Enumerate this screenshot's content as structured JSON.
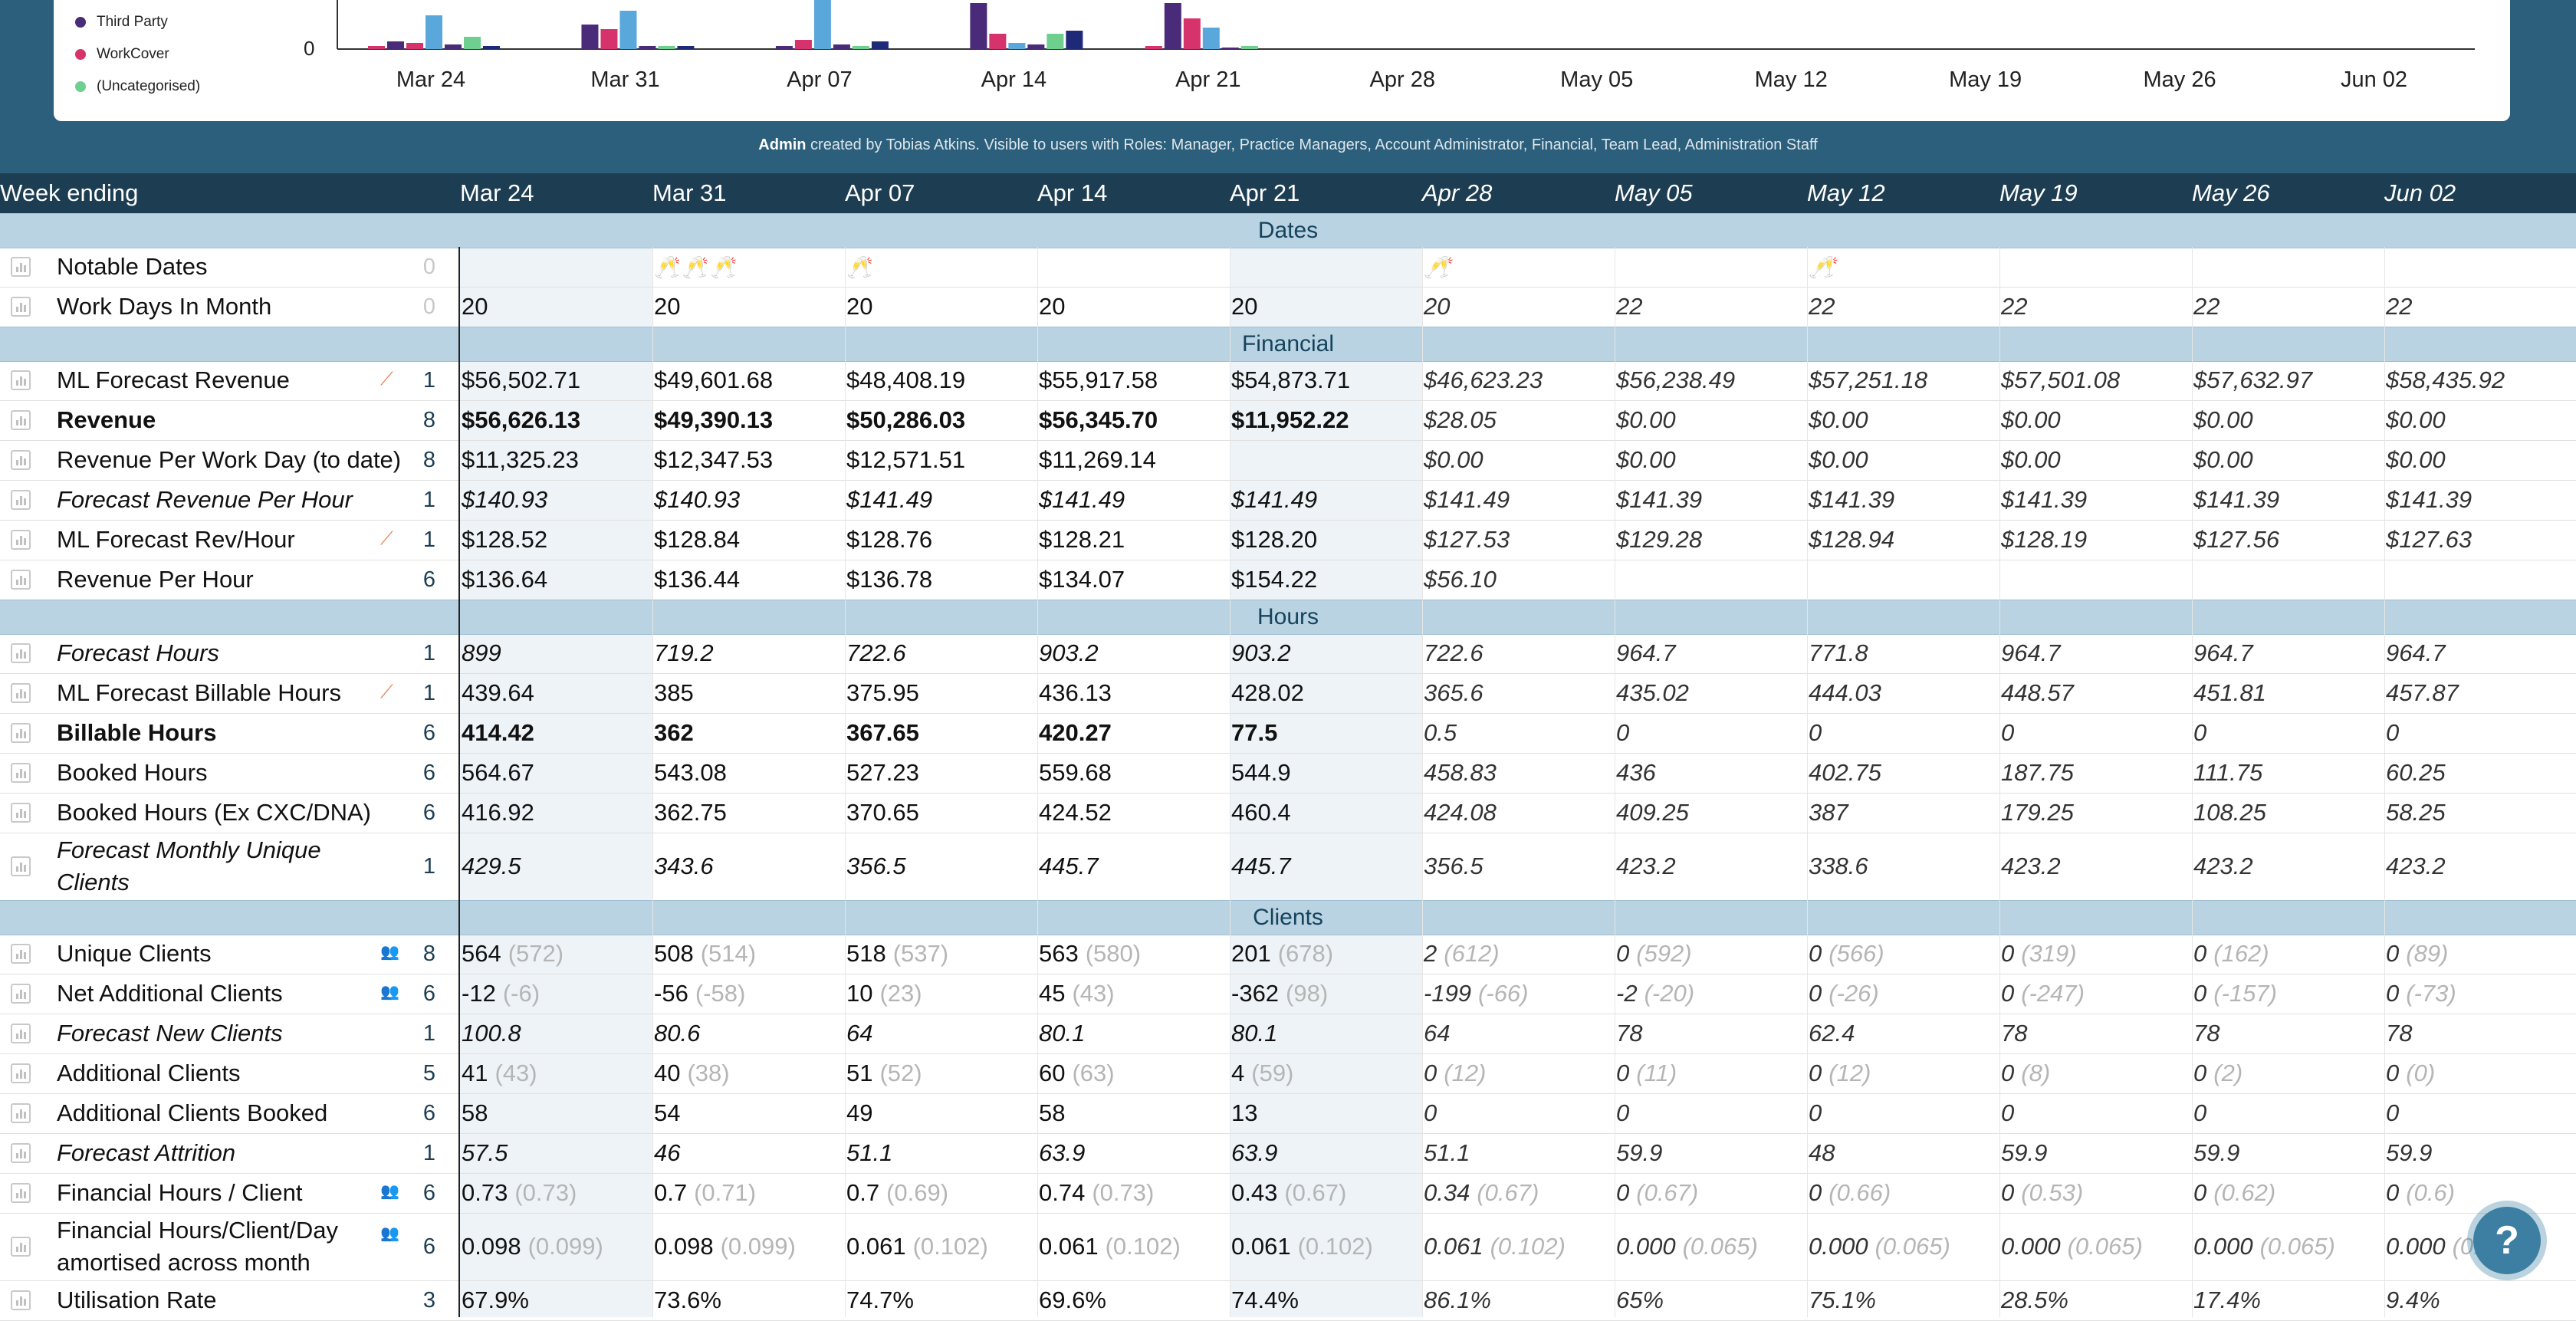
{
  "chart": {
    "legend": [
      {
        "label": "Third Party",
        "color": "#4a2b7a"
      },
      {
        "label": "WorkCover",
        "color": "#d6336c"
      },
      {
        "label": "(Uncategorised)",
        "color": "#6fcf8f"
      }
    ],
    "zero_label": "0",
    "x_labels": [
      "Mar 24",
      "Mar 31",
      "Apr 07",
      "Apr 14",
      "Apr 21",
      "Apr 28",
      "May 05",
      "May 12",
      "May 19",
      "May 26",
      "Jun 02"
    ]
  },
  "chart_data": {
    "type": "bar",
    "categories": [
      "Mar 24",
      "Mar 31",
      "Apr 07",
      "Apr 14",
      "Apr 21",
      "Apr 28",
      "May 05",
      "May 12",
      "May 19",
      "May 26",
      "Jun 02"
    ],
    "series": [
      {
        "color": "#d6336c",
        "values": [
          2,
          0,
          0,
          0,
          2,
          0,
          0,
          0,
          0,
          0,
          0
        ]
      },
      {
        "color": "#4a2b7a",
        "values": [
          5,
          16,
          2,
          30,
          30,
          0,
          0,
          0,
          0,
          0,
          0
        ]
      },
      {
        "color": "#d6336c",
        "values": [
          4,
          13,
          6,
          10,
          20,
          0,
          0,
          0,
          0,
          0,
          0
        ]
      },
      {
        "color": "#5aa7dc",
        "values": [
          22,
          25,
          32,
          4,
          14,
          0,
          0,
          0,
          0,
          0,
          0
        ]
      },
      {
        "color": "#4a2b7a",
        "values": [
          3,
          2,
          3,
          3,
          1,
          0,
          0,
          0,
          0,
          0,
          0
        ]
      },
      {
        "color": "#6fcf8f",
        "values": [
          8,
          2,
          2,
          10,
          2,
          0,
          0,
          0,
          0,
          0,
          0
        ]
      },
      {
        "color": "#1e2a78",
        "values": [
          2,
          2,
          5,
          12,
          0,
          0,
          0,
          0,
          0,
          0,
          0
        ]
      }
    ]
  },
  "admin_note": {
    "admin": "Admin",
    "rest": " created by Tobias Atkins. Visible to users with Roles: Manager, Practice Managers, Account Administrator, Financial, Team Lead, Administration Staff"
  },
  "header": {
    "first": "Week ending",
    "weeks": [
      "Mar 24",
      "Mar 31",
      "Apr 07",
      "Apr 14",
      "Apr 21",
      "Apr 28",
      "May 05",
      "May 12",
      "May 19",
      "May 26",
      "Jun 02"
    ]
  },
  "sections": {
    "dates": "Dates",
    "financial": "Financial",
    "hours": "Hours",
    "clients": "Clients"
  },
  "rows": {
    "notable": {
      "label": "Notable Dates",
      "count": "0",
      "values": [
        "",
        "🥂🥂🥂",
        "🥂",
        "",
        "",
        "🥂",
        "",
        "🥂",
        "",
        "",
        ""
      ]
    },
    "workdays": {
      "label": "Work Days In Month",
      "count": "0",
      "values": [
        "20",
        "20",
        "20",
        "20",
        "20",
        "20",
        "22",
        "22",
        "22",
        "22",
        "22"
      ]
    },
    "ml_rev": {
      "label": "ML Forecast Revenue",
      "count": "1",
      "values": [
        "$56,502.71",
        "$49,601.68",
        "$48,408.19",
        "$55,917.58",
        "$54,873.71",
        "$46,623.23",
        "$56,238.49",
        "$57,251.18",
        "$57,501.08",
        "$57,632.97",
        "$58,435.92"
      ]
    },
    "revenue": {
      "label": "Revenue",
      "count": "8",
      "values": [
        "$56,626.13",
        "$49,390.13",
        "$50,286.03",
        "$56,345.70",
        "$11,952.22",
        "$28.05",
        "$0.00",
        "$0.00",
        "$0.00",
        "$0.00",
        "$0.00"
      ]
    },
    "rev_wd": {
      "label": "Revenue Per Work Day (to date)",
      "count": "8",
      "values": [
        "$11,325.23",
        "$12,347.53",
        "$12,571.51",
        "$11,269.14",
        "",
        "$0.00",
        "$0.00",
        "$0.00",
        "$0.00",
        "$0.00",
        "$0.00"
      ]
    },
    "frph": {
      "label": "Forecast Revenue Per Hour",
      "count": "1",
      "values": [
        "$140.93",
        "$140.93",
        "$141.49",
        "$141.49",
        "$141.49",
        "$141.49",
        "$141.39",
        "$141.39",
        "$141.39",
        "$141.39",
        "$141.39"
      ]
    },
    "ml_rph": {
      "label": "ML Forecast Rev/Hour",
      "count": "1",
      "values": [
        "$128.52",
        "$128.84",
        "$128.76",
        "$128.21",
        "$128.20",
        "$127.53",
        "$129.28",
        "$128.94",
        "$128.19",
        "$127.56",
        "$127.63"
      ]
    },
    "rph": {
      "label": "Revenue Per Hour",
      "count": "6",
      "values": [
        "$136.64",
        "$136.44",
        "$136.78",
        "$134.07",
        "$154.22",
        "$56.10",
        "",
        "",
        "",
        "",
        ""
      ]
    },
    "fh": {
      "label": "Forecast Hours",
      "count": "1",
      "values": [
        "899",
        "719.2",
        "722.6",
        "903.2",
        "903.2",
        "722.6",
        "964.7",
        "771.8",
        "964.7",
        "964.7",
        "964.7"
      ]
    },
    "ml_bh": {
      "label": "ML Forecast Billable Hours",
      "count": "1",
      "values": [
        "439.64",
        "385",
        "375.95",
        "436.13",
        "428.02",
        "365.6",
        "435.02",
        "444.03",
        "448.57",
        "451.81",
        "457.87"
      ]
    },
    "bh": {
      "label": "Billable Hours",
      "count": "6",
      "values": [
        "414.42",
        "362",
        "367.65",
        "420.27",
        "77.5",
        "0.5",
        "0",
        "0",
        "0",
        "0",
        "0"
      ]
    },
    "booked": {
      "label": "Booked Hours",
      "count": "6",
      "values": [
        "564.67",
        "543.08",
        "527.23",
        "559.68",
        "544.9",
        "458.83",
        "436",
        "402.75",
        "187.75",
        "111.75",
        "60.25"
      ]
    },
    "booked_ex": {
      "label": "Booked Hours (Ex CXC/DNA)",
      "count": "6",
      "values": [
        "416.92",
        "362.75",
        "370.65",
        "424.52",
        "460.4",
        "424.08",
        "409.25",
        "387",
        "179.25",
        "108.25",
        "58.25"
      ]
    },
    "fmuc": {
      "label_line1": "Forecast Monthly Unique",
      "label_line2": "Clients",
      "count": "1",
      "values": [
        "429.5",
        "343.6",
        "356.5",
        "445.7",
        "445.7",
        "356.5",
        "423.2",
        "338.6",
        "423.2",
        "423.2",
        "423.2"
      ]
    },
    "uc": {
      "label": "Unique Clients",
      "count": "8",
      "values": [
        "564",
        "508",
        "518",
        "563",
        "201",
        "2",
        "0",
        "0",
        "0",
        "0",
        "0"
      ],
      "sub": [
        "(572)",
        "(514)",
        "(537)",
        "(580)",
        "(678)",
        "(612)",
        "(592)",
        "(566)",
        "(319)",
        "(162)",
        "(89)"
      ]
    },
    "nac": {
      "label": "Net Additional Clients",
      "count": "6",
      "values": [
        "-12",
        "-56",
        "10",
        "45",
        "-362",
        "-199",
        "-2",
        "0",
        "0",
        "0",
        "0"
      ],
      "sub": [
        "(-6)",
        "(-58)",
        "(23)",
        "(43)",
        "(98)",
        "(-66)",
        "(-20)",
        "(-26)",
        "(-247)",
        "(-157)",
        "(-73)"
      ]
    },
    "fnc": {
      "label": "Forecast New Clients",
      "count": "1",
      "values": [
        "100.8",
        "80.6",
        "64",
        "80.1",
        "80.1",
        "64",
        "78",
        "62.4",
        "78",
        "78",
        "78"
      ]
    },
    "ac": {
      "label": "Additional Clients",
      "count": "5",
      "values": [
        "41",
        "40",
        "51",
        "60",
        "4",
        "0",
        "0",
        "0",
        "0",
        "0",
        "0"
      ],
      "sub": [
        "(43)",
        "(38)",
        "(52)",
        "(63)",
        "(59)",
        "(12)",
        "(11)",
        "(12)",
        "(8)",
        "(2)",
        "(0)"
      ]
    },
    "acb": {
      "label": "Additional Clients Booked",
      "count": "6",
      "values": [
        "58",
        "54",
        "49",
        "58",
        "13",
        "0",
        "0",
        "0",
        "0",
        "0",
        "0"
      ]
    },
    "fa": {
      "label": "Forecast Attrition",
      "count": "1",
      "values": [
        "57.5",
        "46",
        "51.1",
        "63.9",
        "63.9",
        "51.1",
        "59.9",
        "48",
        "59.9",
        "59.9",
        "59.9"
      ]
    },
    "fhc": {
      "label": "Financial Hours / Client",
      "count": "6",
      "values": [
        "0.73",
        "0.7",
        "0.7",
        "0.74",
        "0.43",
        "0.34",
        "0",
        "0",
        "0",
        "0",
        "0"
      ],
      "sub": [
        "(0.73)",
        "(0.71)",
        "(0.69)",
        "(0.73)",
        "(0.67)",
        "(0.67)",
        "(0.67)",
        "(0.66)",
        "(0.53)",
        "(0.62)",
        "(0.6)"
      ]
    },
    "fhcd": {
      "label_line1": "Financial Hours/Client/Day",
      "label_line2": "amortised across month",
      "count": "6",
      "values": [
        "0.098",
        "0.098",
        "0.061",
        "0.061",
        "0.061",
        "0.061",
        "0.000",
        "0.000",
        "0.000",
        "0.000",
        "0.000"
      ],
      "sub": [
        "(0.099)",
        "(0.099)",
        "(0.102)",
        "(0.102)",
        "(0.102)",
        "(0.102)",
        "(0.065)",
        "(0.065)",
        "(0.065)",
        "(0.065)",
        "(0.0"
      ]
    },
    "util": {
      "label": "Utilisation Rate",
      "count": "3",
      "values": [
        "67.9%",
        "73.6%",
        "74.7%",
        "69.6%",
        "74.4%",
        "86.1%",
        "65%",
        "75.1%",
        "28.5%",
        "17.4%",
        "9.4%"
      ]
    }
  },
  "help": {
    "label": "?"
  }
}
